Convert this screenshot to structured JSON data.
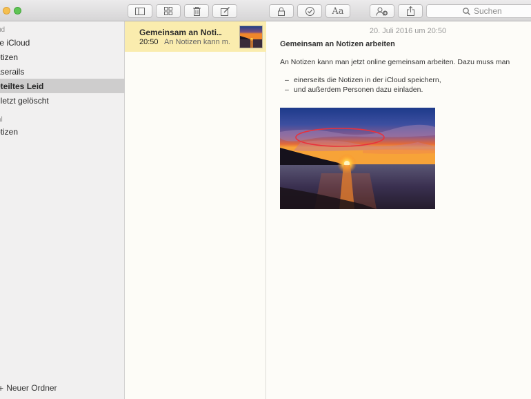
{
  "toolbar": {
    "search": {
      "placeholder": "Suchen"
    },
    "format_label": "Aa",
    "buttons": [
      {
        "name": "sidebar-toggle",
        "icon": "sidebar-icon"
      },
      {
        "name": "gallery-view",
        "icon": "grid-icon"
      },
      {
        "name": "delete-note",
        "icon": "trash-icon"
      },
      {
        "name": "new-note",
        "icon": "compose-icon"
      },
      {
        "name": "lock-note",
        "icon": "lock-icon"
      },
      {
        "name": "checklist",
        "icon": "checkmark-circle-icon"
      },
      {
        "name": "format",
        "icon": "text-format-icon"
      },
      {
        "name": "add-people",
        "icon": "add-people-icon"
      },
      {
        "name": "share",
        "icon": "share-icon"
      }
    ]
  },
  "sidebar": {
    "sections": [
      {
        "header": "ud",
        "items": [
          {
            "label": "lle iCloud",
            "selected": false
          },
          {
            "label": "otizen",
            "selected": false
          },
          {
            "label": "aserails",
            "selected": false
          },
          {
            "label": "eteiltes Leid",
            "selected": true
          },
          {
            "label": "uletzt gelöscht",
            "selected": false
          }
        ]
      },
      {
        "header": "al",
        "items": [
          {
            "label": "otizen",
            "selected": false
          }
        ]
      }
    ],
    "new_folder_label": "Neuer Ordner"
  },
  "notelist": {
    "notes": [
      {
        "title": "Gemeinsam an Noti...",
        "time": "20:50",
        "preview": "An Notizen kann m...",
        "selected": true
      }
    ]
  },
  "note": {
    "date": "20. Juli 2016 um 20:50",
    "title": "Gemeinsam an Notizen arbeiten",
    "paragraph": "An Notizen kann man jetzt online gemeinsam arbeiten. Dazu muss man",
    "bullets": [
      "einerseits die Notizen in der iCloud speichern,",
      "und außerdem Personen dazu einladen."
    ],
    "bullet_dash": "–"
  },
  "colors": {
    "accent_selected_note": "#faecae",
    "sidebar_selected": "#cecdcd",
    "annotation_red": "#e8323c"
  }
}
